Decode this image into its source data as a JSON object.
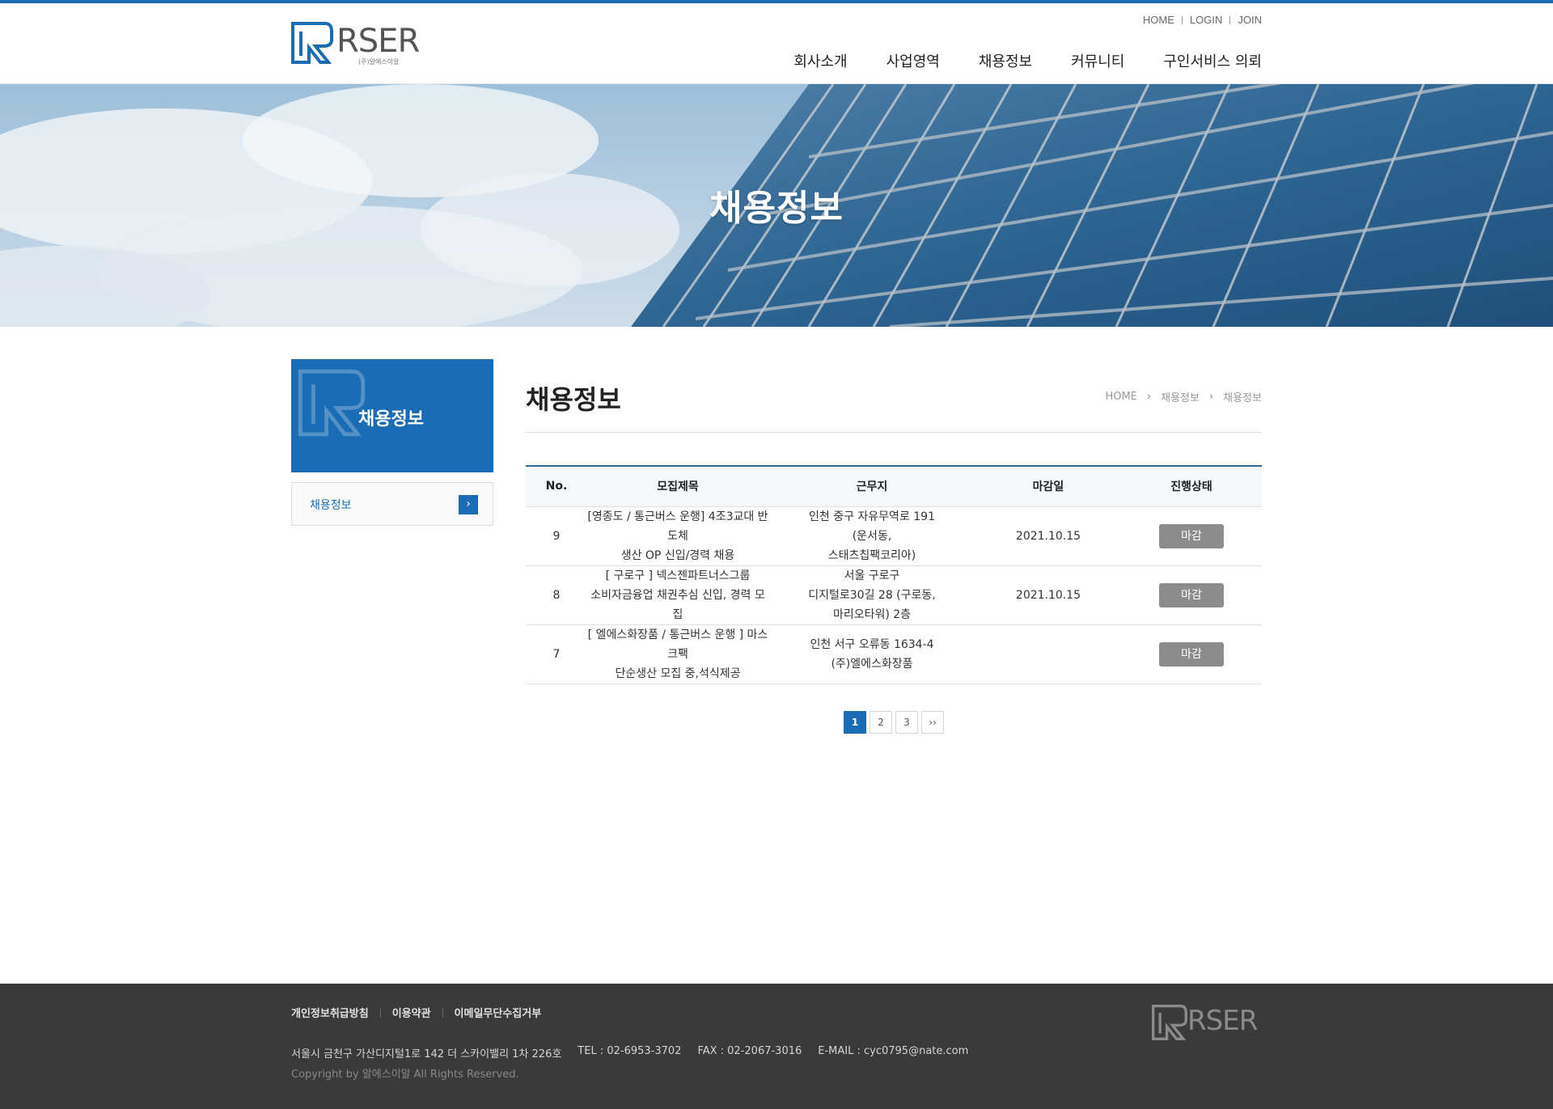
{
  "header": {
    "logo_text": "RSER",
    "logo_sub": "(주)알에스이알",
    "util_links": [
      "HOME",
      "LOGIN",
      "JOIN"
    ],
    "gnb": [
      "회사소개",
      "사업영역",
      "채용정보",
      "커뮤니티",
      "구인서비스 의뢰"
    ]
  },
  "visual": {
    "title": "채용정보"
  },
  "sidebar": {
    "title": "채용정보",
    "items": [
      {
        "label": "채용정보",
        "icon": "chevron-right-icon"
      }
    ]
  },
  "content": {
    "title": "채용정보",
    "breadcrumb": [
      "HOME",
      "채용정보",
      "채용정보"
    ]
  },
  "table": {
    "headers": [
      "No.",
      "모집제목",
      "근무지",
      "마감일",
      "진행상태"
    ],
    "rows": [
      {
        "no": "9",
        "title_lines": [
          "[영종도 / 통근버스 운행] 4조3교대 반도체",
          "생산 OP 신입/경력 채용"
        ],
        "location_lines": [
          "인천 중구 자유무역로 191",
          "(운서동,",
          "스태츠칩팩코리아)"
        ],
        "deadline": "2021.10.15",
        "status": "마감"
      },
      {
        "no": "8",
        "title_lines": [
          "[ 구로구 ] 넥스젠파트너스그룹",
          "소비자금융업 채권추심 신입, 경력 모집"
        ],
        "location_lines": [
          "서울 구로구",
          "디지털로30길 28 (구로동,",
          "마리오타워) 2층"
        ],
        "deadline": "2021.10.15",
        "status": "마감"
      },
      {
        "no": "7",
        "title_lines": [
          "[ 엘에스화장품 / 통근버스 운행 ] 마스크팩",
          "단순생산 모집 중,석식제공"
        ],
        "location_lines": [
          "인천 서구 오류동 1634-4",
          "(주)엘에스화장품"
        ],
        "deadline": "",
        "status": "마감"
      }
    ]
  },
  "pagination": {
    "pages": [
      "1",
      "2",
      "3"
    ],
    "current": "1",
    "next_label": "››"
  },
  "footer": {
    "links": [
      "개인정보취급방침",
      "이용약관",
      "이메일무단수집거부"
    ],
    "address": "서울시 금천구 가산디지털1로 142 더 스카이밸리 1차 226호",
    "tel": "TEL : 02-6953-3702",
    "fax": "FAX : 02-2067-3016",
    "email": "E-MAIL : cyc0795@nate.com",
    "copyright": "Copyright by 알에스이알 All Rights Reserved."
  },
  "colors": {
    "brand": "#1a6db5",
    "footer_bg": "#3a3a3a",
    "status_btn": "#8c8c8c"
  }
}
